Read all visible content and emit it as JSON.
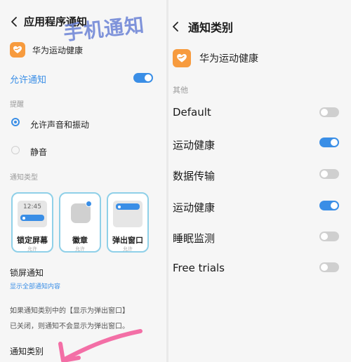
{
  "watermark": "手机通知",
  "left": {
    "title": "应用程序通知",
    "app_name": "华为运动健康",
    "allow_label": "允许通知",
    "allow_on": true,
    "reminder_label": "提醒",
    "radio_sound": "允许声音和振动",
    "radio_silent": "静音",
    "sound_selected": true,
    "type_label": "通知类型",
    "cards": [
      {
        "name": "锁定屏幕",
        "sub": "允许",
        "time": "12:45"
      },
      {
        "name": "徽章",
        "sub": "允许"
      },
      {
        "name": "弹出窗口",
        "sub": "允许"
      }
    ],
    "lock_title": "锁屏通知",
    "lock_sub": "显示全部通知内容",
    "info_line1": "如果通知类别中的【显示为弹出窗口】",
    "info_line2": "已关闭，则通知不会显示为弹出窗口。",
    "category_link": "通知类别"
  },
  "right": {
    "title": "通知类别",
    "app_name": "华为运动健康",
    "other_label": "其他",
    "rows": [
      {
        "label": "Default",
        "on": false
      },
      {
        "label": "运动健康",
        "on": true
      },
      {
        "label": "数据传输",
        "on": false
      },
      {
        "label": "运动健康",
        "on": true
      },
      {
        "label": "睡眠监测",
        "on": false
      },
      {
        "label": "Free trials",
        "on": false
      }
    ]
  },
  "colors": {
    "accent": "#3a8ee6",
    "app_icon": "#f79b3e",
    "card_border": "#8fd0e8",
    "arrow": "#f36fa6"
  }
}
